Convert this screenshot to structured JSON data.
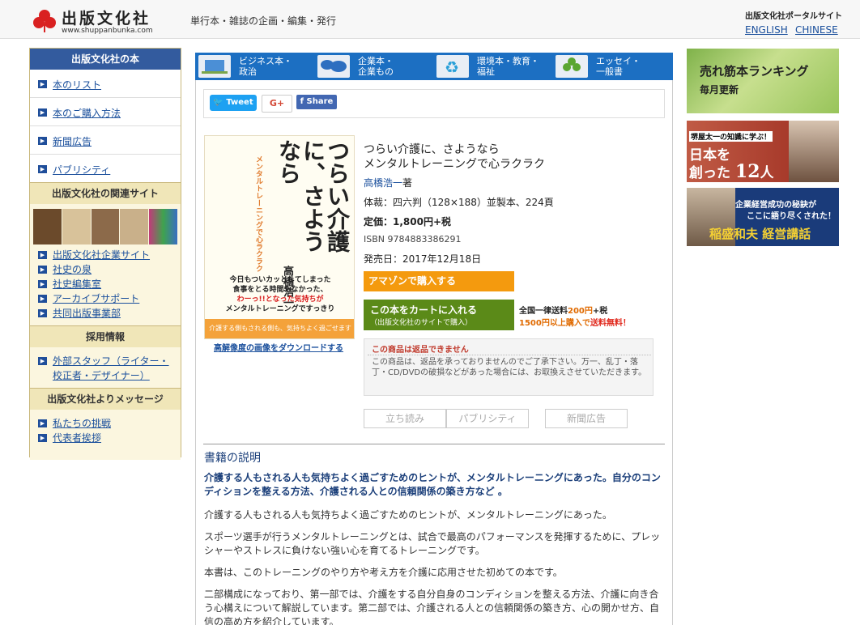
{
  "header": {
    "logo_text": "出版文化社",
    "logo_url": "www.shuppanbunka.com",
    "tagline": "単行本・雑誌の企画・編集・発行",
    "portal": "出版文化社ポータルサイト",
    "lang_en": "ENGLISH",
    "lang_cn": "CHINESE"
  },
  "sidebar": {
    "books_header": "出版文化社の本",
    "books_items": [
      {
        "label": "本のリスト"
      },
      {
        "label": "本のご購入方法"
      },
      {
        "label": "新聞広告"
      },
      {
        "label": "パブリシティ"
      }
    ],
    "related_header": "出版文化社の関連サイト",
    "related_items": [
      {
        "label": "出版文化社企業サイト"
      },
      {
        "label": "社史の泉"
      },
      {
        "label": "社史編集室"
      },
      {
        "label": "アーカイブサポート"
      },
      {
        "label": "共同出版事業部"
      }
    ],
    "recruit_header": "採用情報",
    "recruit_items": [
      {
        "label": "外部スタッフ（ライター・校正者・デザイナー）"
      }
    ],
    "message_header": "出版文化社よりメッセージ",
    "message_items": [
      {
        "label": "私たちの挑戦"
      },
      {
        "label": "代表者挨拶"
      }
    ]
  },
  "categories": [
    {
      "line1": "ビジネス本・",
      "line2": "政治",
      "icon": "laptop-icon"
    },
    {
      "line1": "企業本・",
      "line2": "企業もの",
      "icon": "world-map-icon"
    },
    {
      "line1": "環境本・教育・",
      "line2": "福祉",
      "icon": "recycle-icon"
    },
    {
      "line1": "エッセイ・",
      "line2": "一般書",
      "icon": "clover-icon"
    }
  ],
  "social": {
    "tweet": "Tweet",
    "gplus": "G+",
    "share": "Share"
  },
  "book": {
    "cover": {
      "title": "つらい介護に、さようなら",
      "subtitle": "メンタルトレーニングで心ラクラク",
      "author": "高橋浩一",
      "blurb1": "今日もついカッとしてしまった",
      "blurb2": "食事をとる時間もなかった、",
      "blurb3": "わーっ!!となった気持ちが",
      "blurb4": "メンタルトレーニングですっきり",
      "band": "介護する側もされる側も、気持ちよく過ごせます",
      "publisher": "出版文化社"
    },
    "download_link": "高解像度の画像をダウンロードする",
    "title_line1": "つらい介護に、さようなら",
    "title_line2": "メンタルトレーニングで心ラクラク",
    "author_name": "高橋浩一",
    "author_suffix": "著",
    "spec": "体裁：四六判（128×188）並製本、224頁",
    "price": "定価：1,800円+税",
    "isbn": "ISBN 9784883386291",
    "pubdate": "発売日：2017年12月18日",
    "amazon_btn": "アマゾンで購入する",
    "cart_btn": "この本をカートに入れる",
    "cart_btn_sub": "（出版文化社のサイトで購入）",
    "ship_a": "全国一律送料",
    "ship_b": "200円",
    "ship_c": "+税",
    "ship_d": "1500円以上購入で",
    "ship_e": "送料無料！",
    "notice_title": "この商品は返品できません",
    "notice_body": "この商品は、返品を承っておりませんのでご了承下さい。万一、乱丁・落丁・CD/DVDの破損などがあった場合には、お取換えさせていただきます。",
    "tabs": [
      "立ち読み",
      "パブリシティ",
      "新聞広告"
    ]
  },
  "description": {
    "title": "書籍の説明",
    "lead": "介護する人もされる人も気持ちよく過ごすためのヒントが、メンタルトレーニングにあった。自分のコンディションを整える方法、介護される人との信頼関係の築き方など 。",
    "p1": "介護する人もされる人も気持ちよく過ごすためのヒントが、メンタルトレーニングにあった。",
    "p2": "スポーツ選手が行うメンタルトレーニングとは、試合で最高のパフォーマンスを発揮するために、プレッシャーやストレスに負けない強い心を育てるトレーニングです。",
    "p3": "本書は、このトレーニングのやり方や考え方を介護に応用させた初めての本です。",
    "p4": "二部構成になっており、第一部では、介護をする自分自身のコンディションを整える方法、介護に向き合う心構えについて解説しています。第二部では、介護される人との信頼関係の築き方、心の開かせ方、自信の高め方を紹介しています。"
  },
  "right_banners": {
    "ranking_title": "売れ筋本ランキング",
    "ranking_sub": "毎月更新",
    "sakaiya_lead": "堺屋太一の知識に学ぶ！",
    "sakaiya_title1": "日本を",
    "sakaiya_title2": "創った",
    "sakaiya_num": "12",
    "sakaiya_suffix": "人",
    "inamori_line1": "企業経営成功の秘訣が",
    "inamori_line2": "ここに語り尽くされた！",
    "inamori_title": "稲盛和夫 経営講話"
  }
}
